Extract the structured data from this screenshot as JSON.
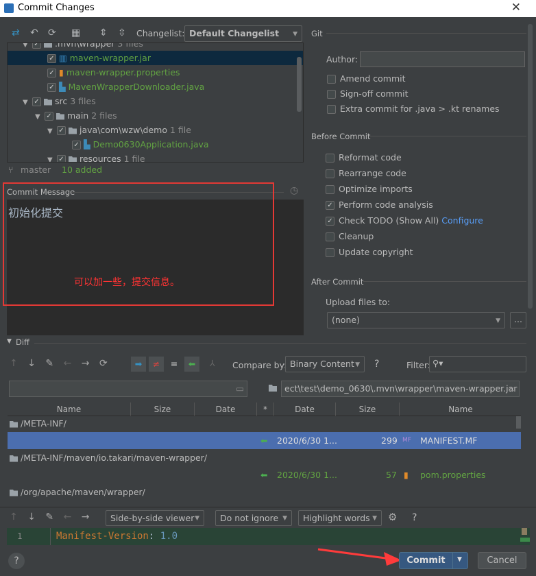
{
  "window": {
    "title": "Commit Changes",
    "close": "✕"
  },
  "toolbar": {
    "changelist_label": "Changelist:",
    "changelist_value": "Default Changelist"
  },
  "tree": {
    "rows": [
      {
        "name": ".mvn\\wrapper",
        "count": "3 files"
      },
      {
        "name": "maven-wrapper.jar"
      },
      {
        "name": "maven-wrapper.properties"
      },
      {
        "name": "MavenWrapperDownloader.java"
      },
      {
        "name": "src",
        "count": "3 files"
      },
      {
        "name": "main",
        "count": "2 files"
      },
      {
        "name": "java\\com\\wzw\\demo",
        "count": "1 file"
      },
      {
        "name": "Demo0630Application.java"
      },
      {
        "name": "resources",
        "count": "1 file"
      }
    ]
  },
  "status": {
    "branch": "master",
    "added": "10 added"
  },
  "commit_message": {
    "label": "Commit Message",
    "text": "初始化提交",
    "annotation": "可以加一些，提交信息。"
  },
  "git": {
    "title": "Git",
    "author_label": "Author:",
    "author_value": "",
    "options": [
      {
        "label": "Amend commit",
        "checked": false
      },
      {
        "label": "Sign-off commit",
        "checked": false
      },
      {
        "label": "Extra commit for .java > .kt renames",
        "checked": false
      }
    ]
  },
  "before_commit": {
    "title": "Before Commit",
    "options": [
      {
        "label": "Reformat code",
        "checked": false
      },
      {
        "label": "Rearrange code",
        "checked": false
      },
      {
        "label": "Optimize imports",
        "checked": false
      },
      {
        "label": "Perform code analysis",
        "checked": true
      },
      {
        "label": "Check TODO (Show All)",
        "checked": true,
        "link": "Configure"
      },
      {
        "label": "Cleanup",
        "checked": false
      },
      {
        "label": "Update copyright",
        "checked": false
      }
    ]
  },
  "after_commit": {
    "title": "After Commit",
    "upload_label": "Upload files to:",
    "upload_value": "(none)",
    "browse": "..."
  },
  "diff": {
    "title": "Diff",
    "compare_label": "Compare by:",
    "compare_value": "Binary Content",
    "help": "?",
    "filter_label": "Filter:",
    "left_path": "",
    "right_path": "ect\\test\\demo_0630\\.mvn\\wrapper\\maven-wrapper.jar",
    "columns": [
      "Name",
      "Size",
      "Date",
      "*",
      "Date",
      "Size",
      "Name"
    ],
    "rows": [
      {
        "type": "folder",
        "path": "/META-INF/"
      },
      {
        "type": "file",
        "date": "2020/6/30 1...",
        "size": "299",
        "name": "MANIFEST.MF",
        "selected": true
      },
      {
        "type": "folder",
        "path": "/META-INF/maven/io.takari/maven-wrapper/"
      },
      {
        "type": "file",
        "date": "2020/6/30 1...",
        "size": "57",
        "name": "pom.properties",
        "selected": false
      },
      {
        "type": "folder",
        "path": "/org/apache/maven/wrapper/"
      }
    ]
  },
  "viewer": {
    "mode": "Side-by-side viewer",
    "ignore": "Do not ignore",
    "highlight": "Highlight words",
    "help": "?",
    "line_no": "1",
    "code_key": "Manifest-Version",
    "code_sep": ":",
    "code_val": " 1.0"
  },
  "footer": {
    "help": "?",
    "commit": "Commit",
    "cancel": "Cancel"
  },
  "colors": {
    "accent": "#365880",
    "annotation": "#ff3333",
    "added": "#62a342"
  }
}
